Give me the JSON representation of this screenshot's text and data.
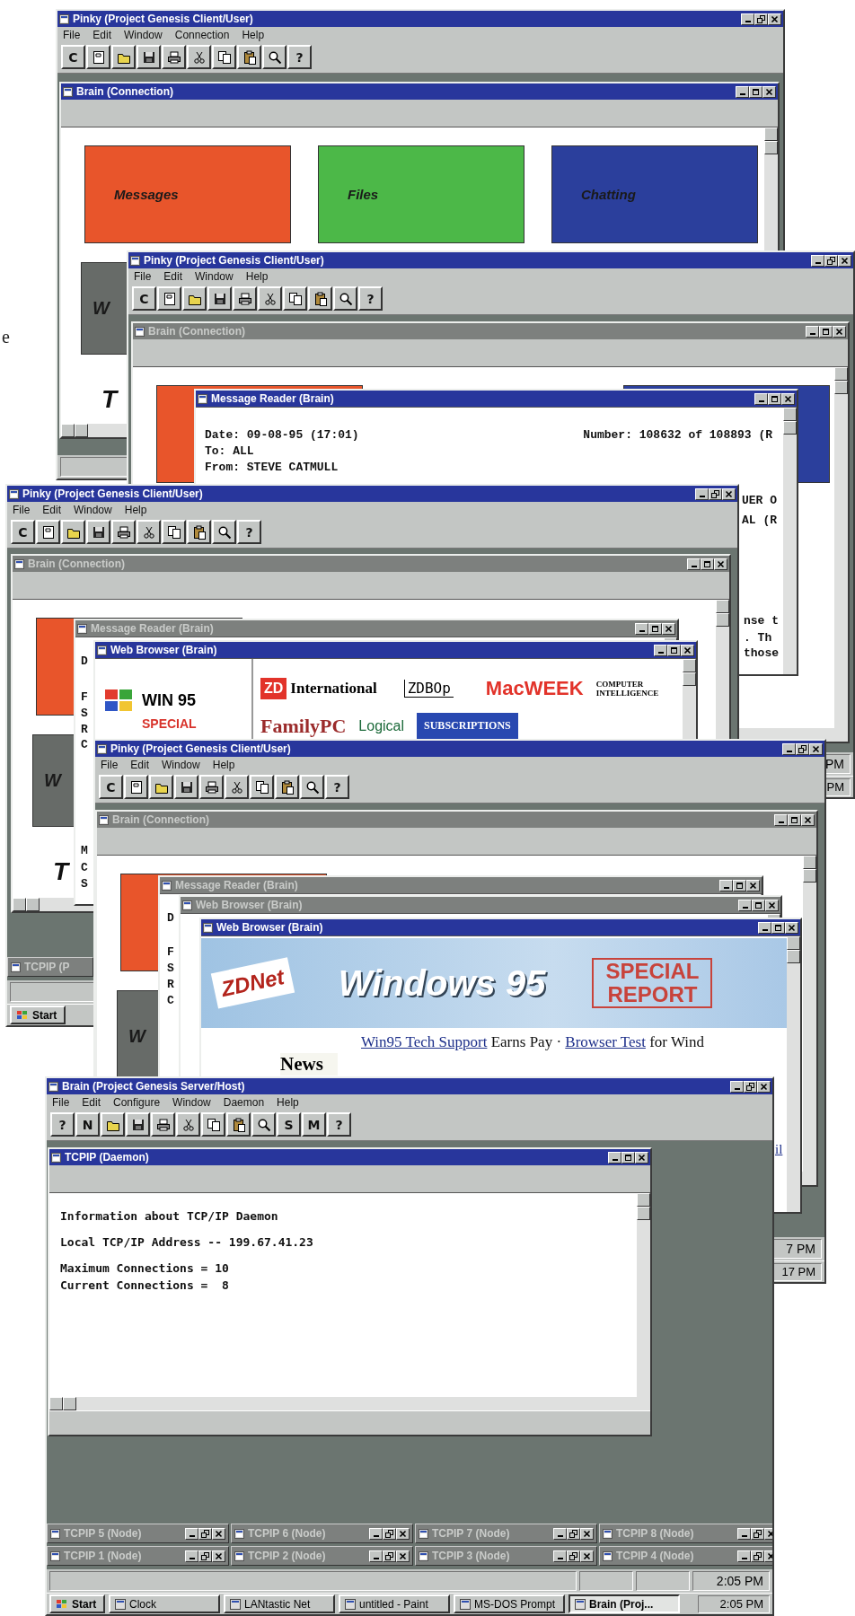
{
  "margin_text": "e",
  "windows": [
    {
      "title": "Pinky (Project Genesis Client/User)",
      "active": true,
      "menu": [
        "File",
        "Edit",
        "Window",
        "Connection",
        "Help"
      ],
      "toolbar": [
        {
          "kind": "letter",
          "text": "C"
        },
        {
          "kind": "page"
        },
        {
          "kind": "open"
        },
        {
          "kind": "save"
        },
        {
          "kind": "print"
        },
        {
          "kind": "cut"
        },
        {
          "kind": "copy"
        },
        {
          "kind": "paste"
        },
        {
          "kind": "search"
        },
        {
          "kind": "letter",
          "text": "?"
        }
      ],
      "children": [
        {
          "title": "Brain (Connection)",
          "kind": "tiles",
          "active": true,
          "tiles": [
            {
              "label": "Messages",
              "color": "#e8552b"
            },
            {
              "label": "Files",
              "color": "#4cb848"
            },
            {
              "label": "Chatting",
              "color": "#2b3f9c"
            },
            {
              "label": "W",
              "color": "#676b68"
            }
          ],
          "caption": "T"
        }
      ]
    },
    {
      "title": "Pinky (Project Genesis Client/User)",
      "active": true,
      "menu": [
        "File",
        "Edit",
        "Window",
        "Help"
      ],
      "toolbar": [
        {
          "kind": "letter",
          "text": "C"
        },
        {
          "kind": "page"
        },
        {
          "kind": "open"
        },
        {
          "kind": "save"
        },
        {
          "kind": "print"
        },
        {
          "kind": "cut"
        },
        {
          "kind": "copy"
        },
        {
          "kind": "paste"
        },
        {
          "kind": "search"
        },
        {
          "kind": "letter",
          "text": "?"
        }
      ],
      "children": [
        {
          "title": "Brain (Connection)",
          "kind": "tiles",
          "active": false,
          "tiles": [
            {
              "color": "#e8552b"
            },
            {
              "color": "#2b3f9c"
            }
          ]
        },
        {
          "title": "Message Reader (Brain)",
          "kind": "reader",
          "active": true,
          "header": [
            "Date: 09-08-95 (17:01)",
            "Number: 108632 of 108893 (R"
          ],
          "lines": [
            "To: ALL",
            "From: STEVE CATMULL"
          ]
        }
      ],
      "fragments": [
        {
          "text": "UER O",
          "kind": "mono"
        },
        {
          "text": "AL (R",
          "kind": "mono"
        },
        {
          "text": "nse t",
          "kind": "mono"
        },
        {
          "text": ". Th",
          "kind": "mono"
        },
        {
          "text": "those",
          "kind": "mono"
        }
      ],
      "status_clock": "PM",
      "taskbar": {
        "clock": "PM"
      }
    },
    {
      "title": "Pinky (Project Genesis Client/User)",
      "active": true,
      "menu": [
        "File",
        "Edit",
        "Window",
        "Help"
      ],
      "toolbar": [
        {
          "kind": "letter",
          "text": "C"
        },
        {
          "kind": "page"
        },
        {
          "kind": "open"
        },
        {
          "kind": "save"
        },
        {
          "kind": "print"
        },
        {
          "kind": "cut"
        },
        {
          "kind": "copy"
        },
        {
          "kind": "paste"
        },
        {
          "kind": "search"
        },
        {
          "kind": "letter",
          "text": "?"
        }
      ],
      "children": [
        {
          "title": "Brain (Connection)",
          "kind": "tiles",
          "active": false,
          "tiles": [
            {
              "color": "#e8552b"
            },
            {
              "label": "W",
              "color": "#676b68"
            }
          ],
          "caption": "T"
        },
        {
          "title": "Message Reader (Brain)",
          "kind": "reader",
          "active": false
        },
        {
          "title": "Web Browser (Brain)",
          "kind": "logos",
          "active": true,
          "sidebar": [
            {
              "text": "WIN 95",
              "kind": "win"
            },
            {
              "text": "SPECIAL",
              "kind": "stamp"
            }
          ],
          "logos": [
            {
              "text": "ZD",
              "kind": "zd"
            },
            {
              "text": "International",
              "kind": "serif"
            },
            {
              "text": "ZDBOp",
              "kind": "outline"
            },
            {
              "text": "MacWEEK",
              "kind": "mac"
            },
            {
              "text": "COMPUTER INTELLIGENCE",
              "kind": "ci"
            },
            {
              "text": "FamilyPC",
              "kind": "family"
            },
            {
              "text": "Logical",
              "kind": "logical"
            },
            {
              "text": "SUBSCRIPTIONS",
              "kind": "subs"
            }
          ]
        }
      ],
      "fragments": [
        {
          "text": "D",
          "kind": "mono"
        },
        {
          "text": "F",
          "kind": "mono"
        },
        {
          "text": "S",
          "kind": "mono"
        },
        {
          "text": "R",
          "kind": "mono"
        },
        {
          "text": "C",
          "kind": "mono"
        },
        {
          "text": "M",
          "kind": "mono"
        },
        {
          "text": "C",
          "kind": "mono"
        },
        {
          "text": "S",
          "kind": "mono"
        }
      ],
      "minimized": [
        "TCPIP (P"
      ],
      "taskbar": {
        "buttons": [
          {
            "label": "Start",
            "kind": "start",
            "pressed": false
          }
        ]
      }
    },
    {
      "title": "Pinky (Project Genesis Client/User)",
      "active": true,
      "menu": [
        "File",
        "Edit",
        "Window",
        "Help"
      ],
      "toolbar": [
        {
          "kind": "letter",
          "text": "C"
        },
        {
          "kind": "page"
        },
        {
          "kind": "open"
        },
        {
          "kind": "save"
        },
        {
          "kind": "print"
        },
        {
          "kind": "cut"
        },
        {
          "kind": "copy"
        },
        {
          "kind": "paste"
        },
        {
          "kind": "search"
        },
        {
          "kind": "letter",
          "text": "?"
        }
      ],
      "children": [
        {
          "title": "Brain (Connection)",
          "kind": "tiles",
          "active": false,
          "tiles": [
            {
              "color": "#e8552b"
            },
            {
              "label": "W",
              "color": "#676b68"
            }
          ]
        },
        {
          "title": "Message Reader (Brain)",
          "kind": "reader",
          "active": false
        },
        {
          "title": "Web Browser (Brain)",
          "kind": "blank",
          "active": false
        },
        {
          "title": "Web Browser (Brain)",
          "kind": "zdnet",
          "active": true,
          "banner": {
            "logo": "ZDNet",
            "title": "Windows 95",
            "stamp": "SPECIAL REPORT"
          },
          "headline": [
            {
              "text": "Win95 Tech Support",
              "link": true
            },
            {
              "text": "Earns Pay ·",
              "link": false
            },
            {
              "text": "Browser Test",
              "link": true
            },
            {
              "text": "for Wind",
              "link": false
            }
          ],
          "news": "News"
        }
      ],
      "fragments": [
        {
          "text": "D",
          "kind": "mono"
        },
        {
          "text": "F",
          "kind": "mono"
        },
        {
          "text": "S",
          "kind": "mono"
        },
        {
          "text": "R",
          "kind": "mono"
        },
        {
          "text": "C",
          "kind": "mono"
        },
        {
          "text": "il",
          "kind": "link"
        }
      ],
      "status_clock": "7 PM",
      "taskbar": {
        "clock": "17 PM"
      }
    },
    {
      "title": "Brain (Project Genesis Server/Host)",
      "active": true,
      "menu": [
        "File",
        "Edit",
        "Configure",
        "Window",
        "Daemon",
        "Help"
      ],
      "toolbar": [
        {
          "kind": "letter",
          "text": "?"
        },
        {
          "kind": "letter",
          "text": "N"
        },
        {
          "kind": "open"
        },
        {
          "kind": "save"
        },
        {
          "kind": "print"
        },
        {
          "kind": "cut"
        },
        {
          "kind": "copy"
        },
        {
          "kind": "paste"
        },
        {
          "kind": "search"
        },
        {
          "kind": "letter",
          "text": "S"
        },
        {
          "kind": "letter",
          "text": "M"
        },
        {
          "kind": "letter",
          "text": "?"
        }
      ],
      "children": [
        {
          "title": "TCPIP (Daemon)",
          "kind": "text",
          "active": true,
          "groups": [
            [
              "Information about TCP/IP Daemon"
            ],
            [
              "Local TCP/IP Address -- 199.67.41.23"
            ],
            [
              "Maximum Connections = 10",
              "Current Connections =  8"
            ]
          ]
        }
      ],
      "minimized": [
        "TCPIP 5 (Node)",
        "TCPIP 6 (Node)",
        "TCPIP 7 (Node)",
        "TCPIP 8 (Node)",
        "TCPIP 1 (Node)",
        "TCPIP 2 (Node)",
        "TCPIP 3 (Node)",
        "TCPIP 4 (Node)"
      ],
      "status_clock": "2:05 PM",
      "taskbar": {
        "buttons": [
          {
            "label": "Start",
            "kind": "start",
            "pressed": false
          },
          {
            "label": "Clock",
            "kind": "app",
            "pressed": false
          },
          {
            "label": "LANtastic Net",
            "kind": "app",
            "pressed": false
          },
          {
            "label": "untitled - Paint",
            "kind": "app",
            "pressed": false
          },
          {
            "label": "MS-DOS Prompt",
            "kind": "app",
            "pressed": false
          },
          {
            "label": "Brain (Proj...",
            "kind": "app",
            "pressed": true
          }
        ],
        "clock": "2:05 PM"
      }
    }
  ]
}
